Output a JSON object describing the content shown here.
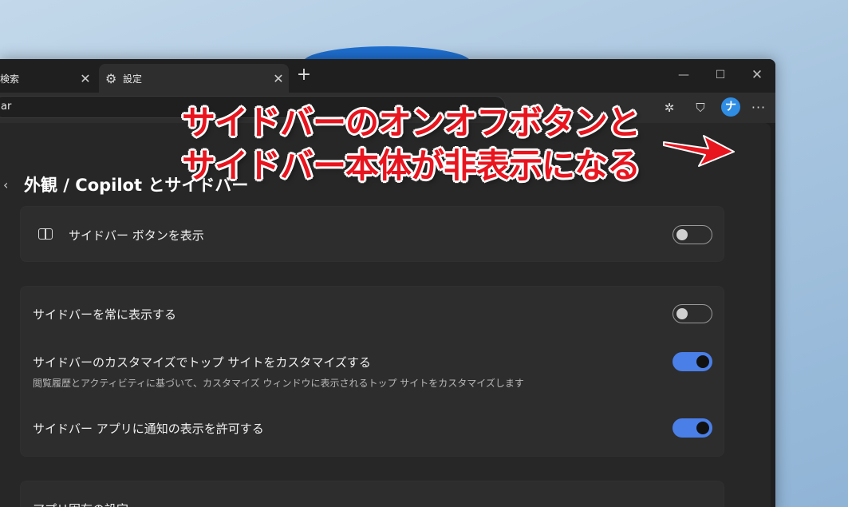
{
  "tabs": [
    {
      "label": "検索",
      "active": false
    },
    {
      "label": "設定",
      "active": true
    }
  ],
  "window_controls": {
    "minimize": "—",
    "maximize": "☐",
    "close": "✕"
  },
  "address_bar": {
    "value": "ar"
  },
  "toolbar_icons": [
    "extensions-icon",
    "shield-icon",
    "profile-icon",
    "more-icon"
  ],
  "page": {
    "title": "外観 / Copilot とサイドバー"
  },
  "settings": {
    "show_sidebar_button": {
      "label": "サイドバー ボタンを表示",
      "enabled": false
    },
    "always_show_sidebar": {
      "label": "サイドバーを常に表示する",
      "enabled": false
    },
    "customize_top_sites": {
      "label": "サイドバーのカスタマイズでトップ サイトをカスタマイズする",
      "description": "閲覧履歴とアクティビティに基づいて、カスタマイズ ウィンドウに表示されるトップ サイトをカスタマイズします",
      "enabled": true
    },
    "app_notifications": {
      "label": "サイドバー アプリに通知の表示を許可する",
      "enabled": true
    },
    "app_specific_settings": {
      "label": "アプリ固有の設定"
    }
  },
  "annotation": {
    "line1": "サイドバーのオンオフボタンと",
    "line2": "サイドバー本体が非表示になる",
    "color": "#e8141e"
  },
  "colors": {
    "toggle_on": "#4a7fe8",
    "window_bg": "#1f1f1f",
    "card_bg": "#2d2d2d"
  }
}
